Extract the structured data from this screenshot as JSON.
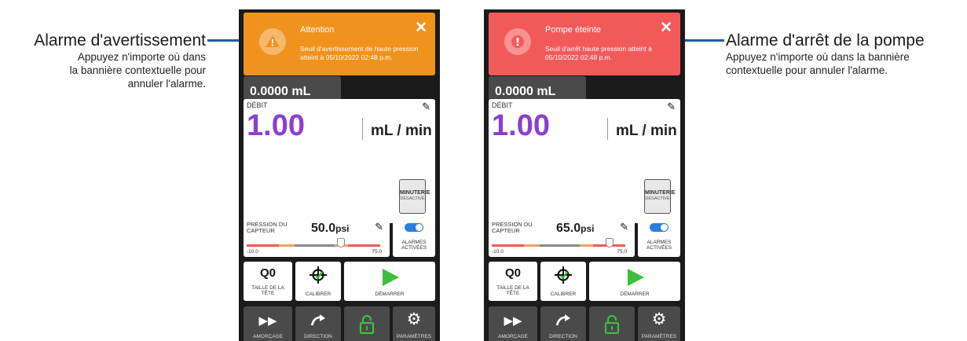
{
  "callouts": {
    "left": {
      "title": "Alarme d'avertissement",
      "desc_line1": "Appuyez n'importe où dans",
      "desc_line2": "la bannière contextuelle pour",
      "desc_line3": "annuler l'alarme."
    },
    "right": {
      "title": "Alarme d'arrêt de la pompe",
      "desc_line1": "Appuyez n'importe où dans la bannière",
      "desc_line2": "contextuelle pour annuler l'alarme."
    }
  },
  "colors": {
    "warning": "#f0921e",
    "stop": "#f25a5a",
    "flow_value": "#8a3fd1",
    "start_green": "#3cc03c",
    "lock_green": "#3cc03c",
    "leader": "#1f5fa8",
    "toggle": "#2b7de0"
  },
  "screens": [
    {
      "banner": {
        "title": "Attention",
        "message": "Seuil d'avertissement de haute pression atteint à 05/10/2022 02:48 p.m.",
        "icon": "warning-triangle-icon"
      },
      "volume": "0.0000 mL",
      "flow": {
        "label": "DÉBIT",
        "value": "1.00",
        "unit": "mL / min"
      },
      "timer": {
        "line1": "MINUTERIE",
        "line2": "DÉSACTIVÉ"
      },
      "pressure": {
        "label": "PRESSION DU CAPTEUR",
        "value": "50.0",
        "unit": "psi",
        "min": "-10.0",
        "max": "75.0",
        "level": 0.706
      },
      "alarms_label": "ALARMES ACTIVÉES",
      "head": {
        "value": "Q0",
        "label": "TAILLE DE LA TÊTE"
      },
      "calibrate": "CALIBRER",
      "start": "DÉMARRER",
      "bottom": [
        "AMORÇAGE",
        "DIRECTION",
        "",
        "PARAMÈTRES"
      ]
    },
    {
      "banner": {
        "title": "Pompe éteinte",
        "message": "Seuil d'arrêt haute pression atteint à 05/10/2022 02:48 p.m.",
        "icon": "error-exclamation-icon"
      },
      "volume": "0.0000 mL",
      "flow": {
        "label": "DÉBIT",
        "value": "1.00",
        "unit": "mL / min"
      },
      "timer": {
        "line1": "MINUTERIE",
        "line2": "DÉSACTIVÉ"
      },
      "pressure": {
        "label": "PRESSION DU CAPTEUR",
        "value": "65.0",
        "unit": "psi",
        "min": "-10.0",
        "max": "75.0",
        "level": 0.882
      },
      "alarms_label": "ALARMES ACTIVÉES",
      "head": {
        "value": "Q0",
        "label": "TAILLE DE LA TÊTE"
      },
      "calibrate": "CALIBRER",
      "start": "DÉMARRER",
      "bottom": [
        "AMORÇAGE",
        "DIRECTION",
        "",
        "PARAMÈTRES"
      ]
    }
  ]
}
